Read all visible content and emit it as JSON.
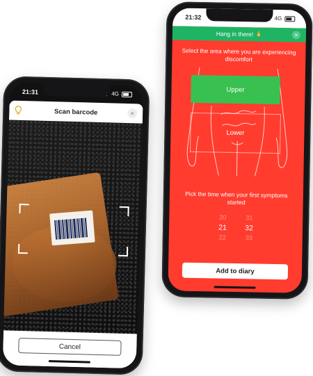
{
  "left_phone": {
    "status": {
      "time": "21:31",
      "network": "4G"
    },
    "header": {
      "title": "Scan barcode",
      "close": "×"
    },
    "cancel_label": "Cancel"
  },
  "right_phone": {
    "status": {
      "time": "21:32",
      "network": "4G"
    },
    "banner": {
      "text": "Hang in there! 🙏",
      "close": "×"
    },
    "area_prompt": "Select the area where you are experiencing discomfort",
    "zones": {
      "upper": "Upper",
      "lower": "Lower"
    },
    "time_prompt": "Pick the time when your first symptoms started",
    "time_picker": {
      "hours": [
        "20",
        "21",
        "22"
      ],
      "minutes": [
        "31",
        "32",
        "33"
      ],
      "selected_hour": "21",
      "selected_minute": "32"
    },
    "add_button": "Add to diary"
  },
  "colors": {
    "background_red": "#ff3c2e",
    "banner_green": "#1fb464",
    "upper_green": "#38c150"
  }
}
